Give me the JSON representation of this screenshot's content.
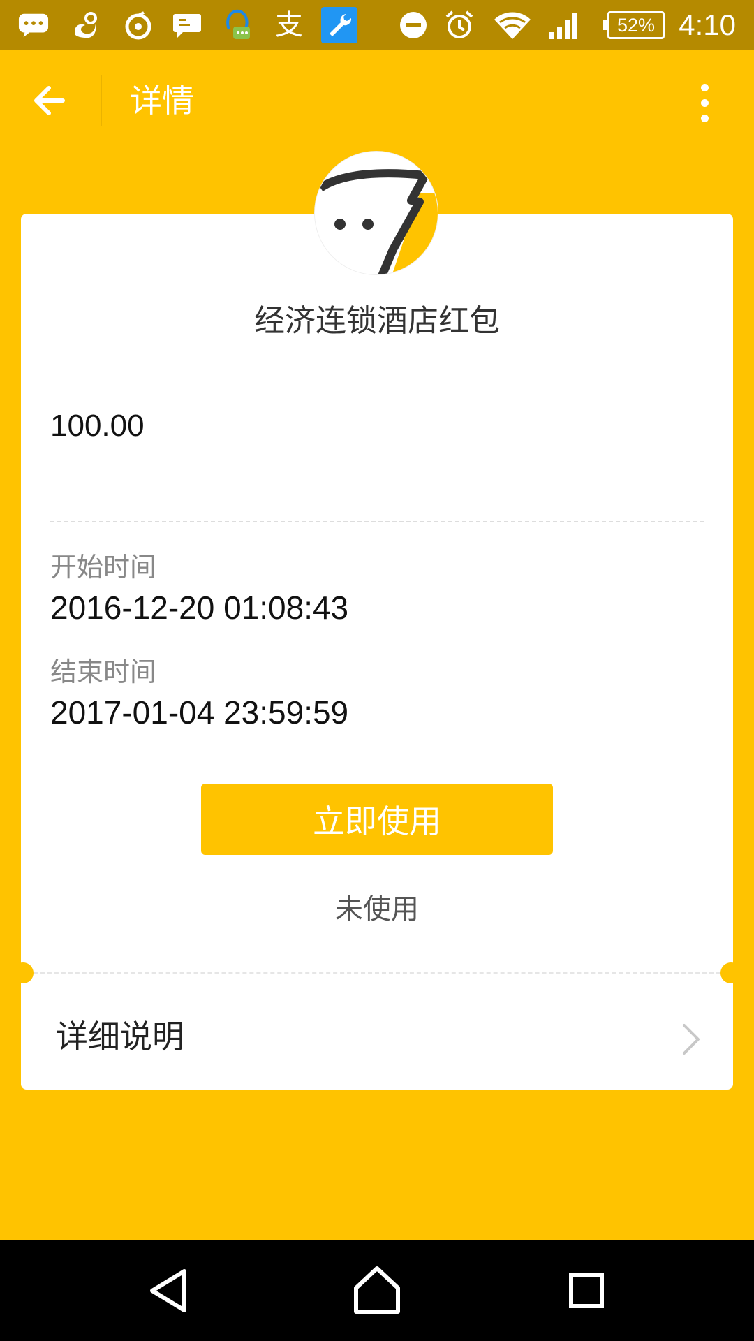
{
  "status_bar": {
    "time": "4:10",
    "battery_percent": "52%",
    "icons": [
      "chat-bubble-icon",
      "uc-browser-icon",
      "netease-icon",
      "message-icon",
      "assistant-icon",
      "alipay-icon",
      "tool-icon",
      "do-not-disturb-icon",
      "alarm-icon",
      "wifi-icon",
      "signal-icon",
      "battery-icon"
    ],
    "alipay_glyph": "支"
  },
  "app_bar": {
    "title": "详情"
  },
  "coupon": {
    "title": "经济连锁酒店红包",
    "amount": "100.00",
    "start_label": "开始时间",
    "start_value": "2016-12-20 01:08:43",
    "end_label": "结束时间",
    "end_value": "2017-01-04 23:59:59",
    "use_button": "立即使用",
    "status": "未使用"
  },
  "details": {
    "label": "详细说明"
  },
  "colors": {
    "accent": "#FFC300",
    "status_bar": "#B58A00",
    "nav_bar": "#000000"
  }
}
